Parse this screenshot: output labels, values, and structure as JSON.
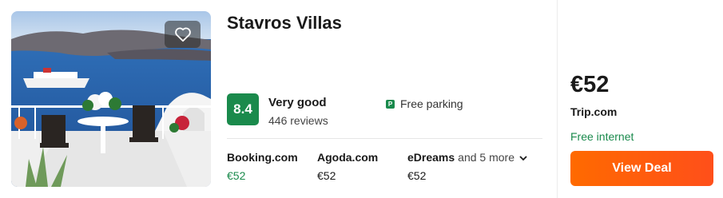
{
  "hotel": {
    "name": "Stavros Villas",
    "rating": "8.4",
    "rating_label": "Very good",
    "reviews": "446 reviews",
    "amenity": "Free parking",
    "amenity_icon": "parking-icon"
  },
  "providers": [
    {
      "name": "Booking.com",
      "price": "€52"
    },
    {
      "name": "Agoda.com",
      "price": "€52"
    },
    {
      "name": "eDreams",
      "price": "€52",
      "more": "and 5 more"
    }
  ],
  "deal": {
    "price": "€52",
    "site": "Trip.com",
    "perk": "Free internet",
    "button": "View Deal"
  },
  "colors": {
    "rating_green": "#1a8a4c",
    "deal_orange": "#ff5a0f"
  }
}
